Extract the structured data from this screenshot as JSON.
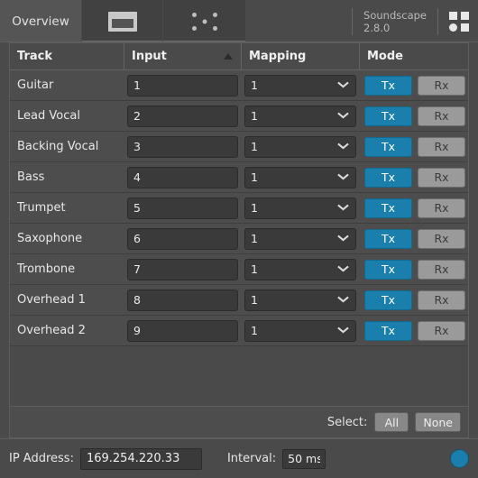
{
  "tabs": [
    {
      "label": "Overview",
      "name": "tab-overview",
      "icon": "",
      "active": true
    },
    {
      "label": "",
      "name": "tab-window",
      "icon": "window-icon",
      "active": false
    },
    {
      "label": "",
      "name": "tab-dots",
      "icon": "five-dots-icon",
      "active": false
    }
  ],
  "brand": {
    "name": "Soundscape",
    "version": "2.8.0",
    "logo_icon": "four-square-logo-icon"
  },
  "table": {
    "columns": [
      {
        "label": "Track",
        "sorted": false
      },
      {
        "label": "Input",
        "sorted": true,
        "sort_direction": "ascending"
      },
      {
        "label": "Mapping",
        "sorted": false
      },
      {
        "label": "Mode",
        "sorted": false
      }
    ],
    "rows": [
      {
        "track": "Guitar",
        "input": "1",
        "mapping": "1",
        "tx": "Tx",
        "rx": "Rx",
        "mode": "Tx"
      },
      {
        "track": "Lead Vocal",
        "input": "2",
        "mapping": "1",
        "tx": "Tx",
        "rx": "Rx",
        "mode": "Tx"
      },
      {
        "track": "Backing Vocal",
        "input": "3",
        "mapping": "1",
        "tx": "Tx",
        "rx": "Rx",
        "mode": "Tx"
      },
      {
        "track": "Bass",
        "input": "4",
        "mapping": "1",
        "tx": "Tx",
        "rx": "Rx",
        "mode": "Tx"
      },
      {
        "track": "Trumpet",
        "input": "5",
        "mapping": "1",
        "tx": "Tx",
        "rx": "Rx",
        "mode": "Tx"
      },
      {
        "track": "Saxophone",
        "input": "6",
        "mapping": "1",
        "tx": "Tx",
        "rx": "Rx",
        "mode": "Tx"
      },
      {
        "track": "Trombone",
        "input": "7",
        "mapping": "1",
        "tx": "Tx",
        "rx": "Rx",
        "mode": "Tx"
      },
      {
        "track": "Overhead 1",
        "input": "8",
        "mapping": "1",
        "tx": "Tx",
        "rx": "Rx",
        "mode": "Tx"
      },
      {
        "track": "Overhead 2",
        "input": "9",
        "mapping": "1",
        "tx": "Tx",
        "rx": "Rx",
        "mode": "Tx"
      }
    ],
    "footer": {
      "select_label": "Select:",
      "all_label": "All",
      "none_label": "None"
    }
  },
  "bottom_bar": {
    "ip_label": "IP Address:",
    "ip_value": "169.254.220.33",
    "interval_label": "Interval:",
    "interval_value": "50 ms",
    "status_indicator": "connected-led"
  },
  "colors": {
    "accent_blue": "#1a7fac",
    "panel_bg": "#4a4a4a",
    "row_bg": "#4d4d4d",
    "field_bg": "#3a3a3a",
    "rx_gray": "#9a9a9a",
    "text": "#e8e8e8"
  }
}
